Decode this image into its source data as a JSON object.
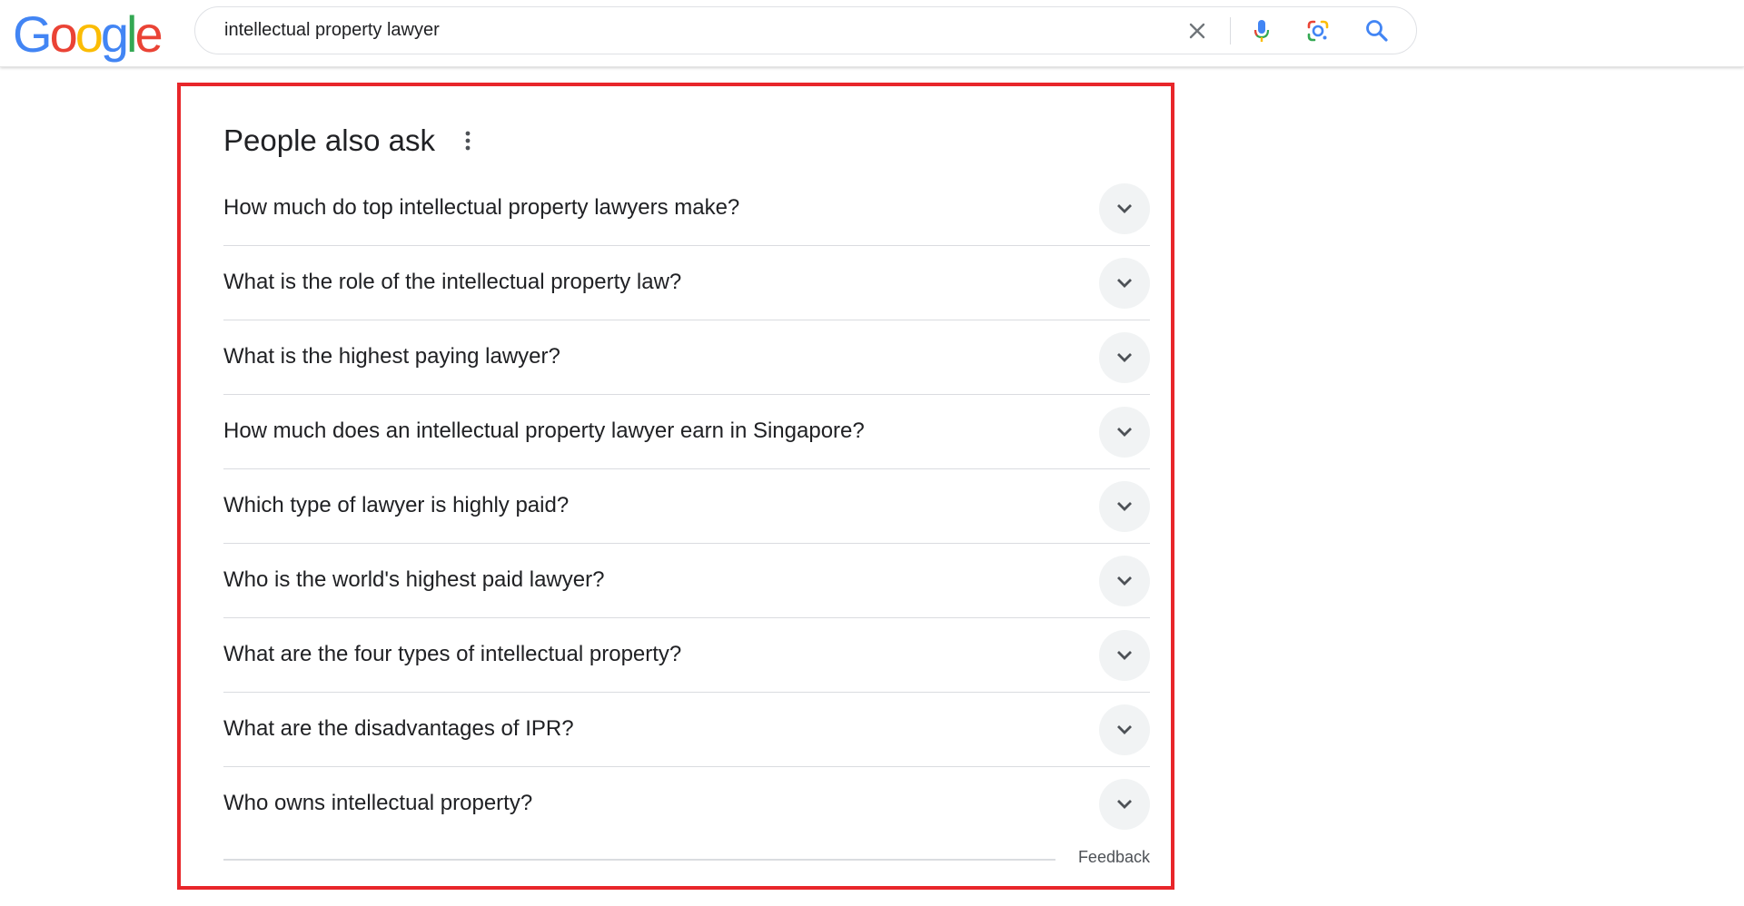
{
  "logo": {
    "letters": [
      "G",
      "o",
      "o",
      "g",
      "l",
      "e"
    ],
    "colors": [
      "#4285f4",
      "#ea4335",
      "#fbbc05",
      "#4285f4",
      "#34a853",
      "#ea4335"
    ]
  },
  "search": {
    "query": "intellectual property lawyer"
  },
  "icons": {
    "clear": "close-icon",
    "voice": "microphone-icon",
    "lens": "google-lens-icon",
    "search": "search-icon",
    "more": "more-vertical-icon",
    "expand": "chevron-down-icon"
  },
  "paa": {
    "title": "People also ask",
    "questions": [
      "How much do top intellectual property lawyers make?",
      "What is the role of the intellectual property law?",
      "What is the highest paying lawyer?",
      "How much does an intellectual property lawyer earn in Singapore?",
      "Which type of lawyer is highly paid?",
      "Who is the world's highest paid lawyer?",
      "What are the four types of intellectual property?",
      "What are the disadvantages of IPR?",
      "Who owns intellectual property?"
    ],
    "feedback_label": "Feedback"
  },
  "colors": {
    "highlight_border": "#e8262a",
    "search_blue": "#4285f4"
  }
}
